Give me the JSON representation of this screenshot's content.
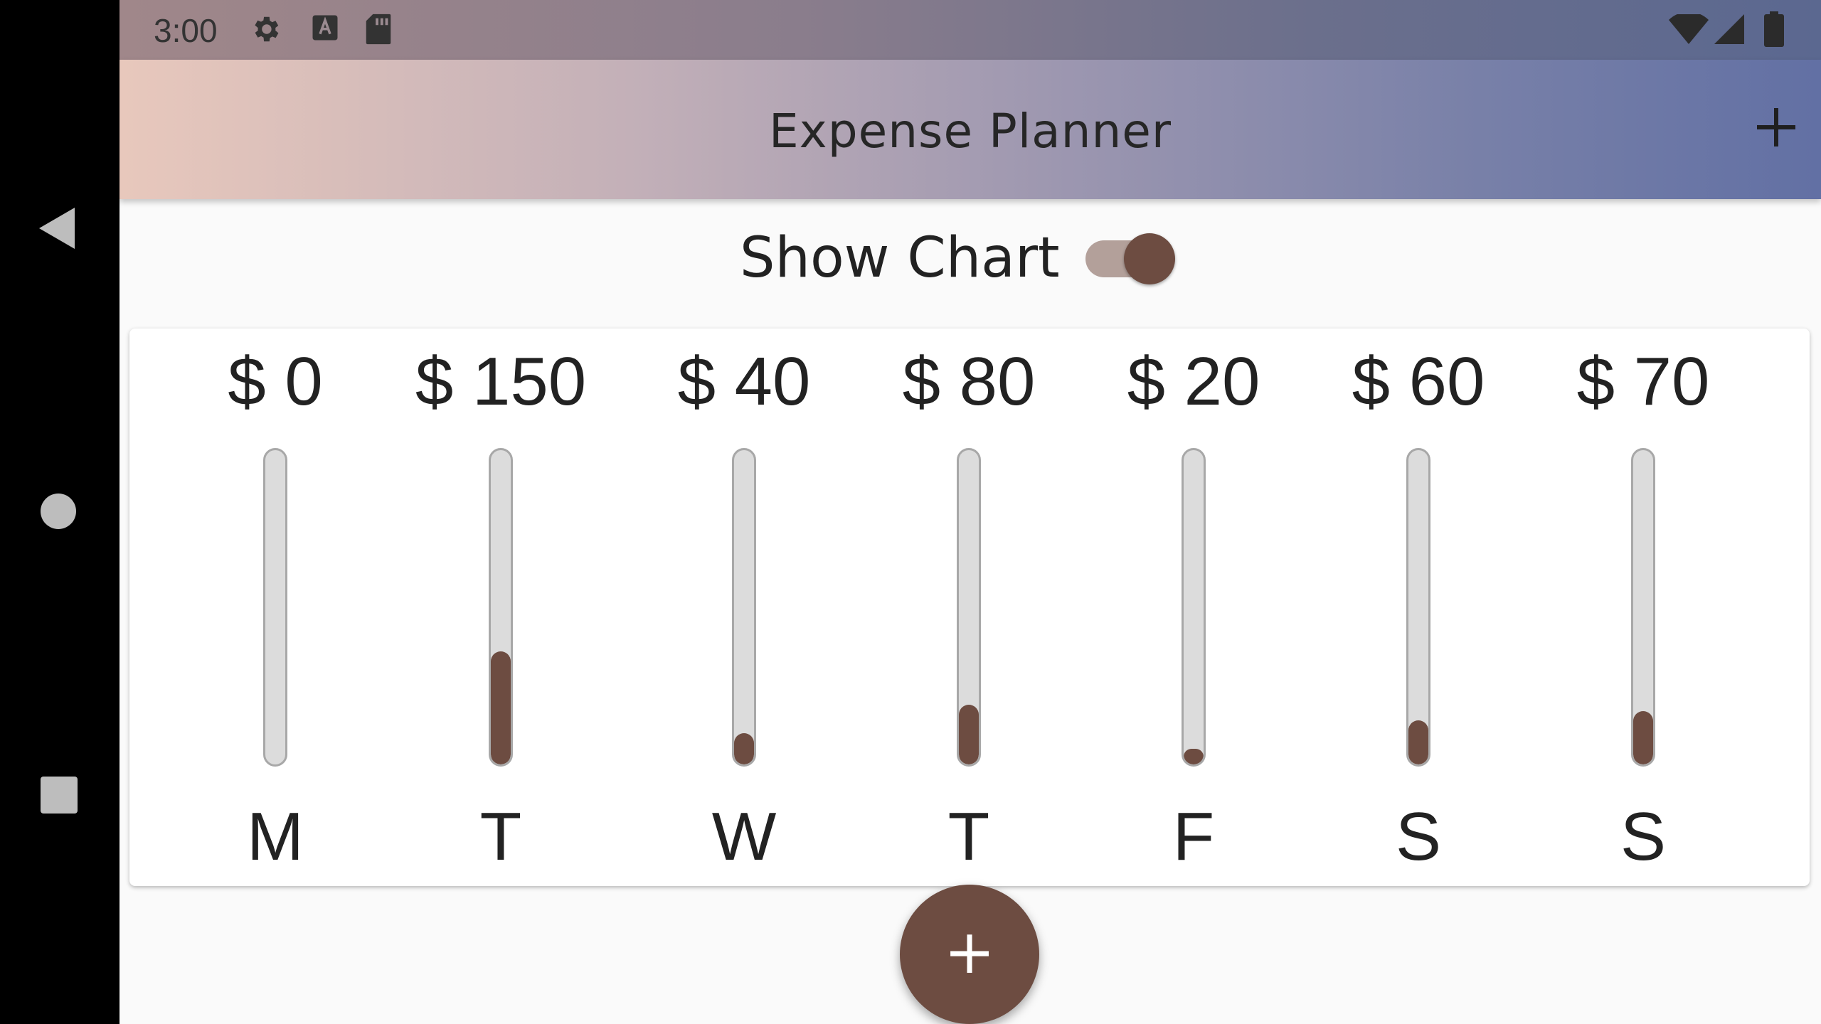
{
  "status_bar": {
    "time": "3:00",
    "left_icons": [
      "gear-icon",
      "text-a-icon",
      "sd-card-icon"
    ],
    "right_icons": [
      "wifi-icon",
      "signal-icon",
      "battery-icon"
    ]
  },
  "app_bar": {
    "title": "Expense Planner",
    "add_icon": "plus-icon"
  },
  "chart_toggle": {
    "label": "Show Chart",
    "checked": true
  },
  "chart_data": {
    "type": "bar",
    "categories": [
      "M",
      "T",
      "W",
      "T",
      "F",
      "S",
      "S"
    ],
    "values": [
      0,
      150,
      40,
      80,
      20,
      60,
      70
    ],
    "value_labels": [
      "$ 0",
      "$ 150",
      "$ 40",
      "$ 80",
      "$ 20",
      "$ 60",
      "$ 70"
    ],
    "fill_fractions": [
      0.0,
      0.36,
      0.1,
      0.19,
      0.05,
      0.14,
      0.17
    ]
  },
  "fab": {
    "label": "+"
  },
  "colors": {
    "primary": "#6d4c41",
    "track": "#dcdcdc",
    "background": "#fafafa"
  }
}
